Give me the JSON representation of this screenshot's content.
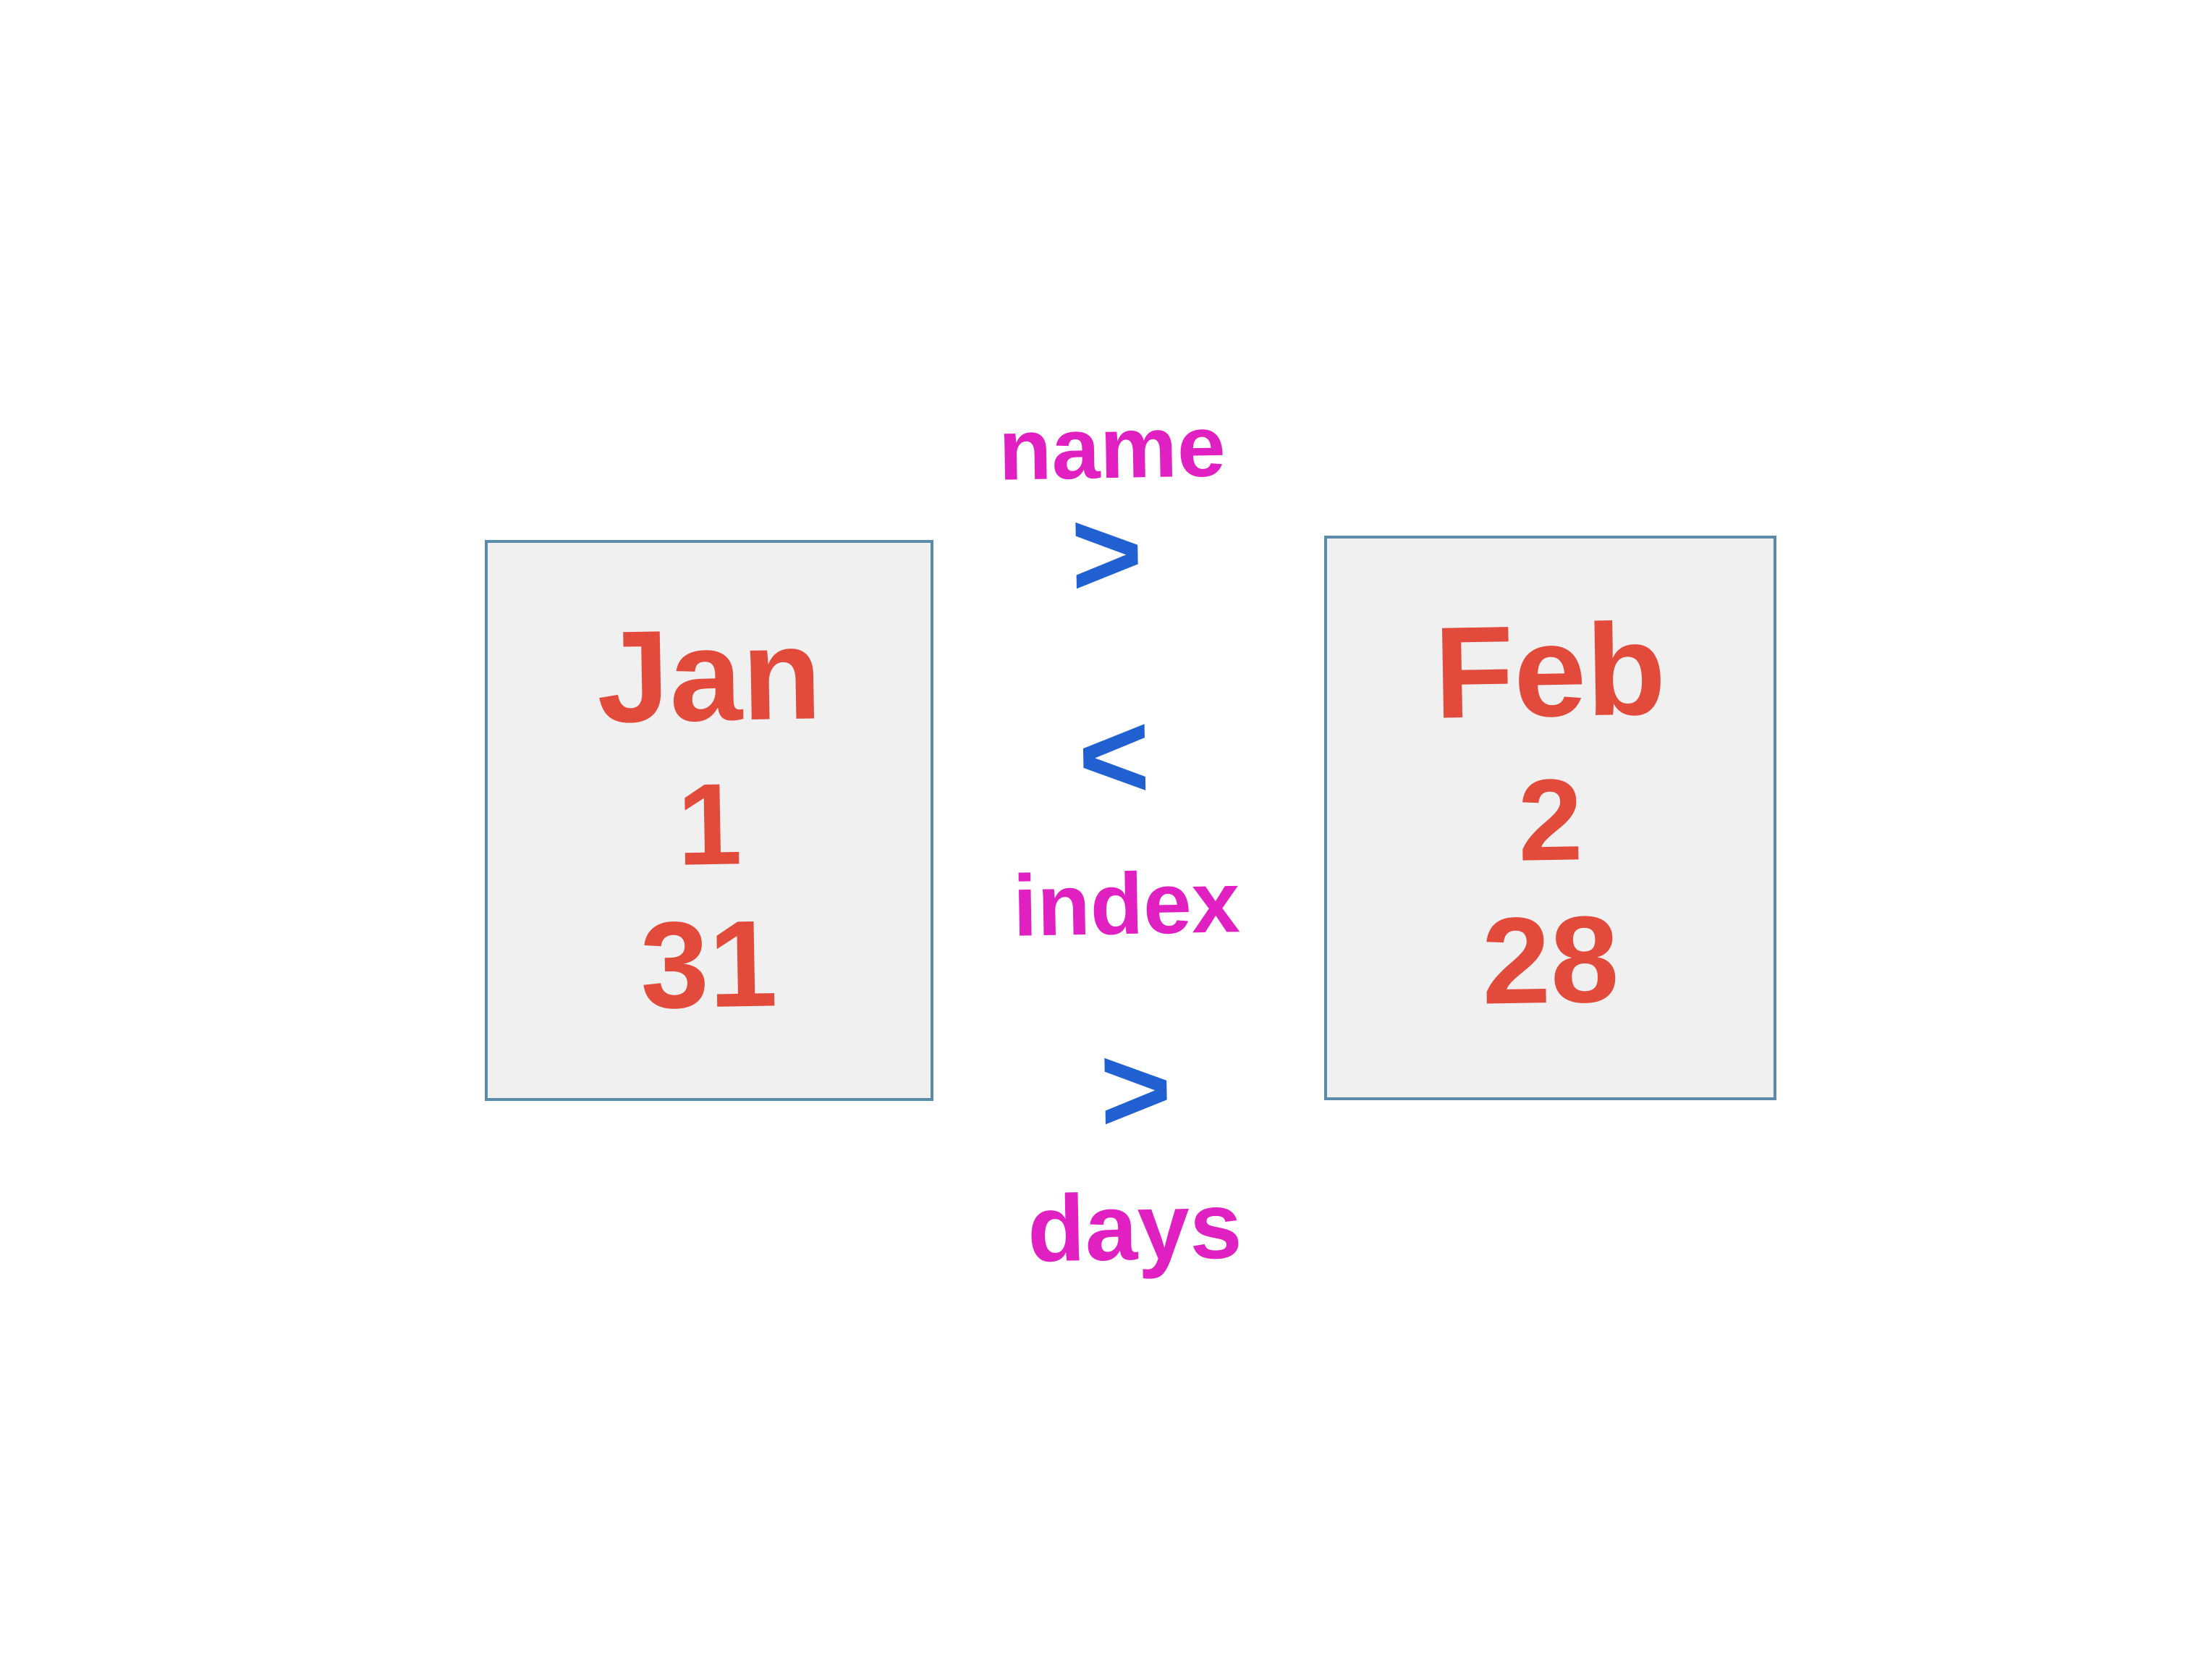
{
  "boxes": {
    "left": {
      "name": "Jan",
      "index": "1",
      "days": "31"
    },
    "right": {
      "name": "Feb",
      "index": "2",
      "days": "28"
    }
  },
  "labels": {
    "name": "name",
    "index": "index",
    "days": "days"
  },
  "comparators": {
    "name": ">",
    "index": "<",
    "days": ">"
  }
}
